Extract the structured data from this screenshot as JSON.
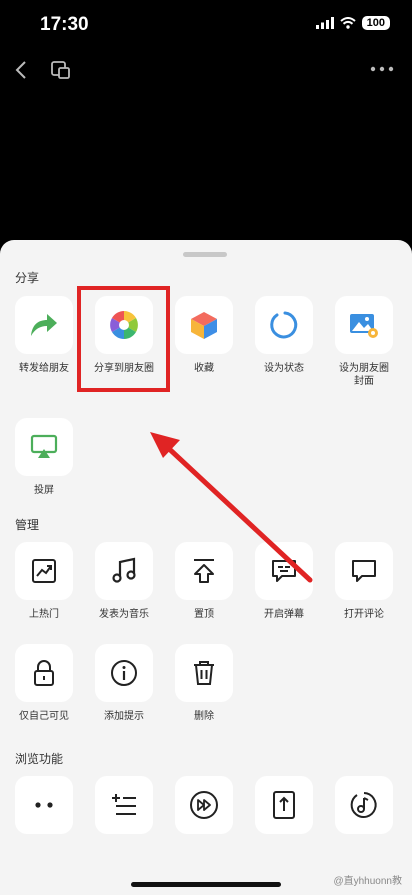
{
  "status_bar": {
    "time": "17:30",
    "battery": "100"
  },
  "sections": {
    "share": {
      "title": "分享",
      "items": [
        {
          "label": "转发给朋友",
          "icon": "forward-arrow-icon"
        },
        {
          "label": "分享到朋友圈",
          "icon": "moments-aperture-icon"
        },
        {
          "label": "收藏",
          "icon": "favorites-cube-icon"
        },
        {
          "label": "设为状态",
          "icon": "status-ring-icon"
        },
        {
          "label": "设为朋友圈\n封面",
          "icon": "moments-cover-icon"
        },
        {
          "label": "投屏",
          "icon": "screen-cast-icon"
        }
      ]
    },
    "manage": {
      "title": "管理",
      "items": [
        {
          "label": "上热门",
          "icon": "trending-chart-icon"
        },
        {
          "label": "发表为音乐",
          "icon": "music-note-icon"
        },
        {
          "label": "置顶",
          "icon": "pin-top-icon"
        },
        {
          "label": "开启弹幕",
          "icon": "danmaku-icon"
        },
        {
          "label": "打开评论",
          "icon": "comment-icon"
        },
        {
          "label": "仅自己可见",
          "icon": "lock-icon"
        },
        {
          "label": "添加提示",
          "icon": "info-icon"
        },
        {
          "label": "删除",
          "icon": "trash-icon"
        }
      ]
    },
    "browse": {
      "title": "浏览功能",
      "items": [
        {
          "icon": "dots-icon"
        },
        {
          "icon": "playlist-icon"
        },
        {
          "icon": "fast-forward-icon"
        },
        {
          "icon": "upload-file-icon"
        },
        {
          "icon": "music-disc-icon"
        }
      ]
    }
  },
  "watermark": "@直yhhuonn教"
}
